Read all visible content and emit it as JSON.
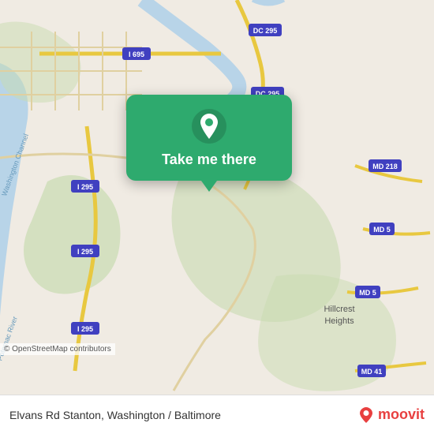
{
  "map": {
    "alt": "Map of Washington DC area showing Elvans Rd Stanton",
    "background_color": "#e8e0d8"
  },
  "popup": {
    "label": "Take me there"
  },
  "bottom_bar": {
    "address": "Elvans Rd Stanton, Washington / Baltimore",
    "credit": "© OpenStreetMap contributors",
    "logo_text": "moovit"
  },
  "road_labels": {
    "i695": "I 695",
    "dc295_top": "DC 295",
    "dc295_mid": "DC 295",
    "md218": "MD 218",
    "md5_1": "MD 5",
    "md5_2": "MD 5",
    "i295_left": "I 295",
    "i295_mid": "I 295",
    "i295_bot": "I 295",
    "md41": "MD 41",
    "hillcrest": "Hillcrest\nHeights"
  }
}
